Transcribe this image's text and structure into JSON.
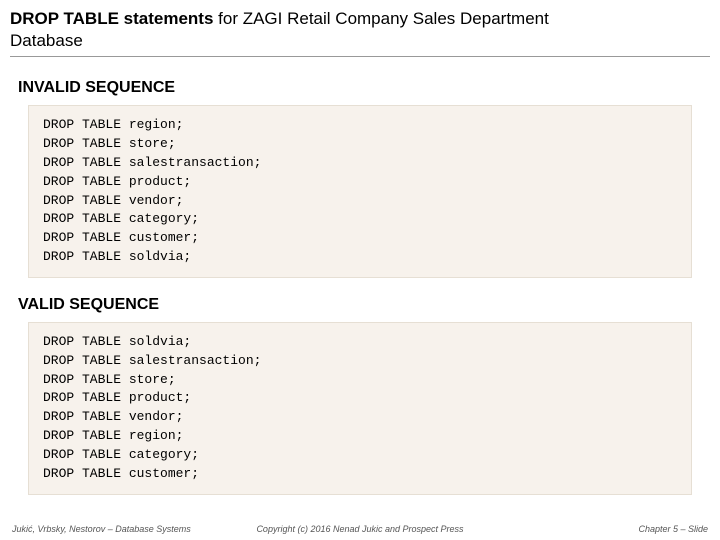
{
  "header": {
    "title_bold": "DROP TABLE statements",
    "title_rest": " for ZAGI Retail Company Sales Department",
    "title_line2": "Database"
  },
  "sections": {
    "invalid": {
      "heading": "INVALID SEQUENCE",
      "code": "DROP TABLE region;\nDROP TABLE store;\nDROP TABLE salestransaction;\nDROP TABLE product;\nDROP TABLE vendor;\nDROP TABLE category;\nDROP TABLE customer;\nDROP TABLE soldvia;"
    },
    "valid": {
      "heading": "VALID SEQUENCE",
      "code": "DROP TABLE soldvia;\nDROP TABLE salestransaction;\nDROP TABLE store;\nDROP TABLE product;\nDROP TABLE vendor;\nDROP TABLE region;\nDROP TABLE category;\nDROP TABLE customer;"
    }
  },
  "footer": {
    "left": "Jukić, Vrbsky, Nestorov – Database Systems",
    "center": "Copyright (c) 2016 Nenad Jukic and Prospect Press",
    "right": "Chapter 5 – Slide"
  }
}
